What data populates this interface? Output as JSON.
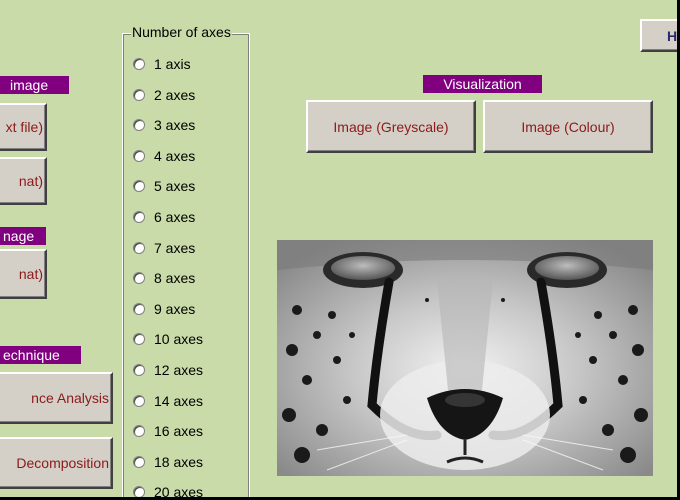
{
  "top_button_label": "H",
  "left_panel": {
    "section1_label": "image",
    "btn_text_file": "xt file)",
    "btn_mat1": "nat)",
    "section2_label": "nage",
    "btn_mat2": "nat)",
    "section3_label": "echnique",
    "btn_analysis": "nce Analysis",
    "btn_decomposition": "Decomposition"
  },
  "axes_group": {
    "title": "Number of axes",
    "options": [
      "1 axis",
      "2 axes",
      "3 axes",
      "4 axes",
      "5 axes",
      "6 axes",
      "7 axes",
      "8 axes",
      "9 axes",
      "10 axes",
      "12 axes",
      "14 axes",
      "16 axes",
      "18 axes",
      "20 axes"
    ]
  },
  "visualization": {
    "label": "Visualization",
    "btn_greyscale": "Image (Greyscale)",
    "btn_colour": "Image (Colour)"
  },
  "image": {
    "subject": "cheetah-face-greyscale"
  },
  "colors": {
    "background": "#c9dba9",
    "label_bg": "#800080",
    "button_text": "#8b1a1a"
  }
}
